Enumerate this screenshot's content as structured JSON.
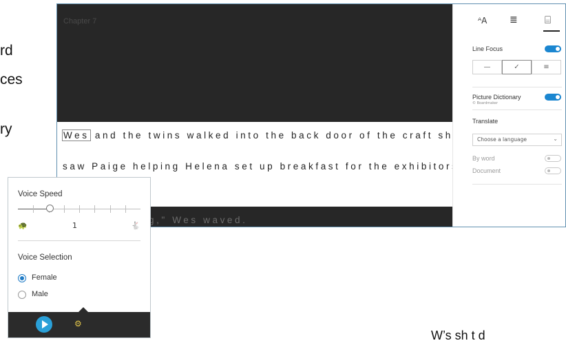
{
  "background": {
    "fragments": [
      "rd",
      "ces",
      "ry",
      "W’s sh t d"
    ]
  },
  "reader": {
    "chapter_label": "Chapter 7",
    "highlighted_word": "Wes",
    "line1_rest": " and the twins walked into the back door of the craft sho",
    "line2": "saw Paige helping Helena set up breakfast for the exhibitors",
    "line3": "g,\" Wes waved."
  },
  "panel": {
    "tabs": {
      "text_prefs_icon": "text-size-icon",
      "text_prefs_glyph": "ᴬA",
      "grammar_glyph": "≣",
      "reading_prefs_glyph": "⌸"
    },
    "line_focus": {
      "label": "Line Focus",
      "enabled": true,
      "options": [
        "—",
        "✓",
        "≡"
      ]
    },
    "picture_dictionary": {
      "label": "Picture Dictionary",
      "sub": "© Boardmaker",
      "enabled": true
    },
    "translate": {
      "label": "Translate",
      "select_placeholder": "Choose a language",
      "by_word_label": "By word",
      "document_label": "Document",
      "by_word_enabled": false,
      "document_enabled": false
    }
  },
  "voice_popup": {
    "speed_label": "Voice Speed",
    "speed_value": "1",
    "speed_fraction": 0.26,
    "slow_glyph": "🐢",
    "fast_glyph": "🐇",
    "selection_label": "Voice Selection",
    "options": [
      {
        "label": "Female",
        "selected": true
      },
      {
        "label": "Male",
        "selected": false
      }
    ]
  },
  "colors": {
    "accent": "#1b86d0",
    "dark_bg": "#272727",
    "play": "#2aa0d8"
  }
}
